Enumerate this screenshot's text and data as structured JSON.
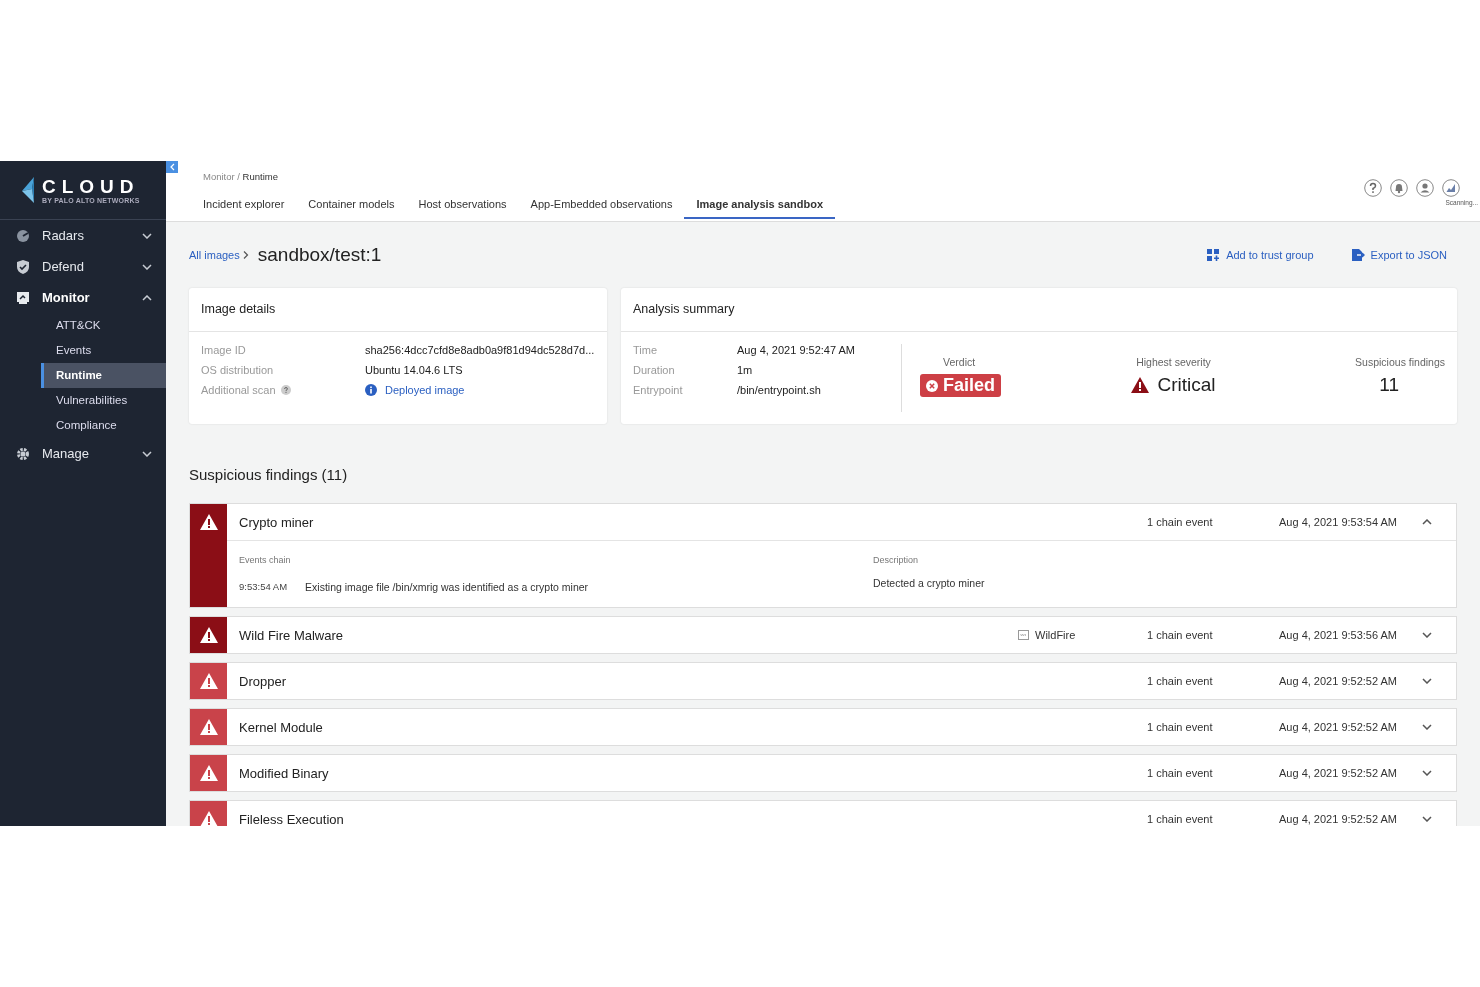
{
  "logo": {
    "name": "CLOUD",
    "tagline": "BY PALO ALTO NETWORKS"
  },
  "sidebar": {
    "items": [
      {
        "label": "Radars",
        "kind": "radar",
        "expanded": false
      },
      {
        "label": "Defend",
        "kind": "shield",
        "expanded": false
      },
      {
        "label": "Monitor",
        "kind": "monitor",
        "expanded": true,
        "children": [
          {
            "label": "ATT&CK",
            "selected": false
          },
          {
            "label": "Events",
            "selected": false
          },
          {
            "label": "Runtime",
            "selected": true
          },
          {
            "label": "Vulnerabilities",
            "selected": false
          },
          {
            "label": "Compliance",
            "selected": false
          }
        ]
      },
      {
        "label": "Manage",
        "kind": "gear",
        "expanded": false
      }
    ]
  },
  "breadcrumb": {
    "parent": "Monitor /",
    "current": "Runtime"
  },
  "tabs": [
    {
      "label": "Incident explorer",
      "selected": false
    },
    {
      "label": "Container models",
      "selected": false
    },
    {
      "label": "Host observations",
      "selected": false
    },
    {
      "label": "App-Embedded observations",
      "selected": false
    },
    {
      "label": "Image analysis sandbox",
      "selected": true
    }
  ],
  "header_status": "Scanning...",
  "page": {
    "back_link": "All images",
    "title": "sandbox/test:1",
    "actions": [
      {
        "label": "Add to trust group",
        "kind": "group"
      },
      {
        "label": "Export to JSON",
        "kind": "export"
      }
    ]
  },
  "image_details": {
    "title": "Image details",
    "rows": [
      {
        "label": "Image ID",
        "value": "sha256:4dcc7cfd8e8adb0a9f81d94dc528d7d...",
        "kind": "text"
      },
      {
        "label": "OS distribution",
        "value": "Ubuntu 14.04.6 LTS",
        "kind": "text"
      },
      {
        "label": "Additional scan",
        "value": "Deployed image",
        "kind": "link"
      }
    ]
  },
  "analysis_summary": {
    "title": "Analysis summary",
    "rows": [
      {
        "label": "Time",
        "value": "Aug 4, 2021 9:52:47 AM"
      },
      {
        "label": "Duration",
        "value": "1m"
      },
      {
        "label": "Entrypoint",
        "value": "/bin/entrypoint.sh"
      }
    ],
    "verdict": {
      "label": "Verdict",
      "value": "Failed"
    },
    "severity": {
      "label": "Highest severity",
      "value": "Critical"
    },
    "findings": {
      "label": "Suspicious findings",
      "value": "11"
    }
  },
  "findings": {
    "heading": "Suspicious findings (11)",
    "items": [
      {
        "title": "Crypto miner",
        "color": "#8b0e16",
        "expanded": true,
        "chain": "1 chain event",
        "time": "Aug 4, 2021 9:53:54 AM",
        "details": {
          "events_label": "Events chain",
          "events": [
            {
              "time": "9:53:54 AM",
              "text": "Existing image file /bin/xmrig was identified as a crypto miner"
            }
          ],
          "description_label": "Description",
          "description": "Detected a crypto miner"
        }
      },
      {
        "title": "Wild Fire Malware",
        "color": "#8b0e16",
        "expanded": false,
        "source": "WildFire",
        "chain": "1 chain event",
        "time": "Aug 4, 2021 9:53:56 AM"
      },
      {
        "title": "Dropper",
        "color": "#c9434a",
        "expanded": false,
        "chain": "1 chain event",
        "time": "Aug 4, 2021 9:52:52 AM"
      },
      {
        "title": "Kernel Module",
        "color": "#c9434a",
        "expanded": false,
        "chain": "1 chain event",
        "time": "Aug 4, 2021 9:52:52 AM"
      },
      {
        "title": "Modified Binary",
        "color": "#c9434a",
        "expanded": false,
        "chain": "1 chain event",
        "time": "Aug 4, 2021 9:52:52 AM"
      },
      {
        "title": "Fileless Execution",
        "color": "#c9434a",
        "expanded": false,
        "chain": "1 chain event",
        "time": "Aug 4, 2021 9:52:52 AM"
      }
    ]
  }
}
